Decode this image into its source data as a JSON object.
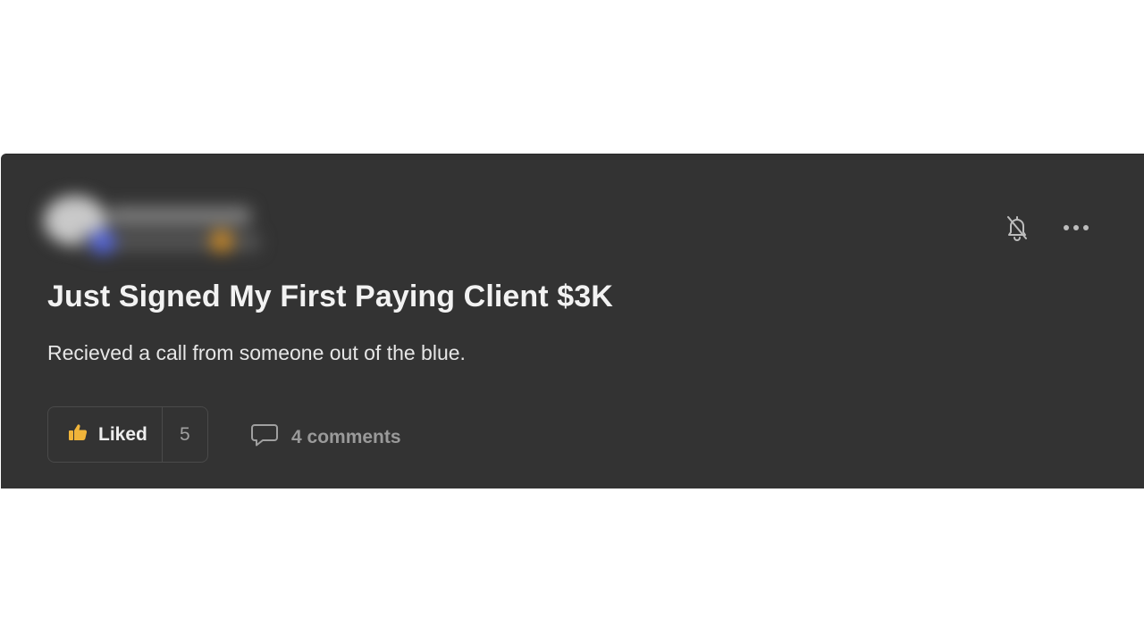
{
  "post": {
    "title": "Just Signed My First Paying Client $3K",
    "body": "Recieved a call from someone out of the blue.",
    "like_label": "Liked",
    "like_count": "5",
    "comments_label": "4 comments"
  },
  "icons": {
    "bell": "bell-off-icon",
    "more": "more-horizontal-icon",
    "like": "thumbs-up-icon",
    "comment": "comment-icon"
  },
  "colors": {
    "card_background": "#333333",
    "like_icon": "#f0b43a"
  }
}
